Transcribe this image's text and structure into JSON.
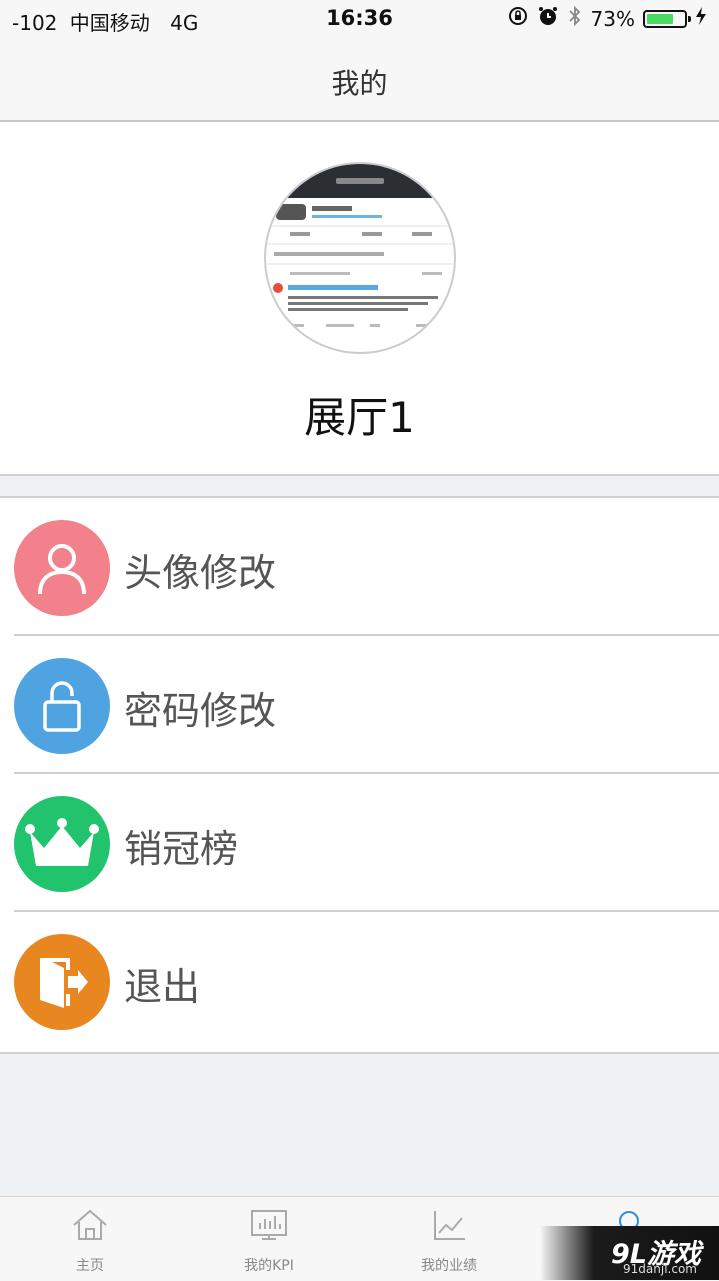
{
  "status_bar": {
    "signal": "-102",
    "carrier": "中国移动",
    "network": "4G",
    "time": "16:36",
    "battery_percent": "73%",
    "battery_level": 0.73
  },
  "nav": {
    "title": "我的"
  },
  "profile": {
    "name": "展厅1"
  },
  "menu": {
    "items": [
      {
        "label": "头像修改",
        "icon": "user-icon",
        "color": "#f2818c"
      },
      {
        "label": "密码修改",
        "icon": "unlock-icon",
        "color": "#4fa3e0"
      },
      {
        "label": "销冠榜",
        "icon": "crown-icon",
        "color": "#21c46d"
      },
      {
        "label": "退出",
        "icon": "exit-door-icon",
        "color": "#e8861f"
      }
    ]
  },
  "tabbar": {
    "tabs": [
      {
        "label": "主页",
        "icon": "home-icon"
      },
      {
        "label": "我的KPI",
        "icon": "kpi-chart-icon"
      },
      {
        "label": "我的业绩",
        "icon": "line-chart-icon"
      },
      {
        "label": "",
        "icon": "profile-icon"
      }
    ]
  },
  "watermark": {
    "logo": "9L游戏",
    "url": "91danji.com"
  }
}
